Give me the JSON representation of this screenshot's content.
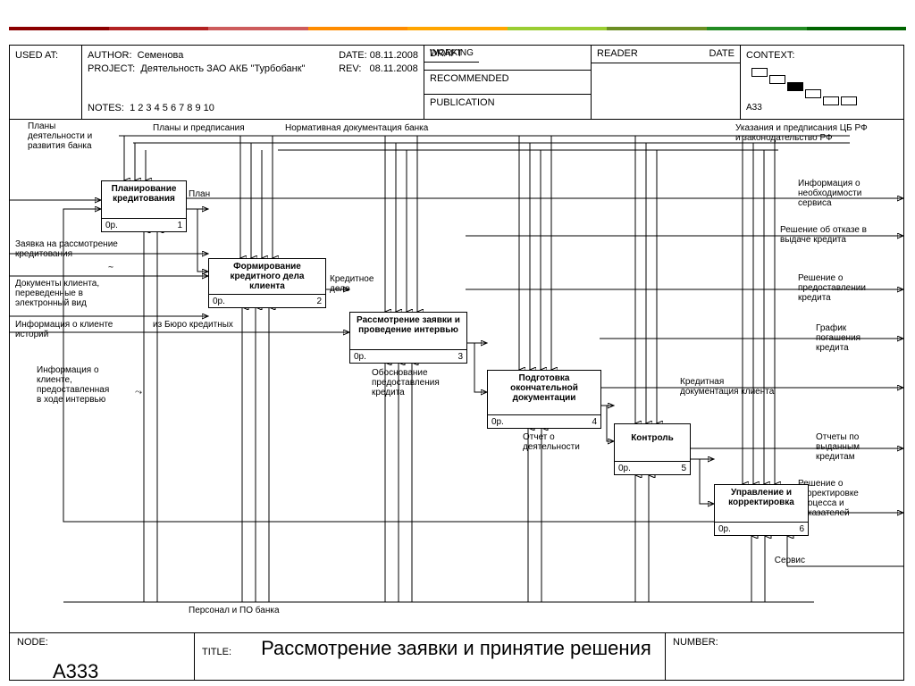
{
  "header": {
    "used_at_label": "USED AT:",
    "author_label": "AUTHOR:",
    "author": "Семенова",
    "project_label": "PROJECT:",
    "project": "Деятельность ЗАО АКБ \"Турбобанк\"",
    "notes_label": "NOTES:",
    "notes": "1  2  3  4  5  6  7  8  9  10",
    "date_label": "DATE:",
    "date": "08.11.2008",
    "rev_label": "REV:",
    "rev": "08.11.2008",
    "status": {
      "working": "WORKING",
      "draft": "DRAFT",
      "recommended": "RECOMMENDED",
      "publication": "PUBLICATION"
    },
    "reader_label": "READER",
    "reader_date_label": "DATE",
    "context_label": "CONTEXT:",
    "context_ref": "A33"
  },
  "activities": [
    {
      "n": "1",
      "op": "0р.",
      "title": "Планирование\nкредитования"
    },
    {
      "n": "2",
      "op": "0р.",
      "title": "Формирование\nкредитного дела клиента"
    },
    {
      "n": "3",
      "op": "0р.",
      "title": "Рассмотрение заявки\nи проведение интервью"
    },
    {
      "n": "4",
      "op": "0р.",
      "title": "Подготовка\nокончательной\nдокументации"
    },
    {
      "n": "5",
      "op": "0р.",
      "title": "Контроль"
    },
    {
      "n": "6",
      "op": "0р.",
      "title": "Управление и\nкорректировка"
    }
  ],
  "labels": {
    "l_plany_deyat": "Планы\nдеятельности и\nразвития банка",
    "l_plany_predp": "Планы и предписания",
    "l_norm_doc": "Нормативная документация банка",
    "l_ukaz_cb": "Указания и предписания ЦБ РФ\nи законодательство РФ",
    "l_plan": "План",
    "l_zayavka": "Заявка на рассмотрение\nкредитования",
    "l_doc_client": "Документы клиента,\nпереведенные в\nэлектронный вид",
    "l_info_client_hist": "Информация о клиенте\nисторий",
    "l_iz_buro": "из Бюро кредитных",
    "l_info_client_interview": "Информация о\nклиенте,\nпредоставленная\nв ходе интервью",
    "l_kred_delo": "Кредитное\nдело",
    "l_obosn": "Обоснование\nпредоставления\nкредита",
    "l_otchet": "Отчет о\nдеятельности",
    "l_info_service": "Информация о\nнеобходимости\nсервиса",
    "l_reshenie_otkaz": "Решение об отказе в\nвыдаче кредита",
    "l_reshenie_pred": "Решение о\nпредоставлении\nкредита",
    "l_grafik": "График\nпогашения\nкредита",
    "l_kred_doc_client": "Кредитная\nдокументация клиента",
    "l_otchety_vyd": "Отчеты по\nвыданным\nкредитам",
    "l_reshenie_korr": "Решение о\nкорректировке\nпроцесса и\nпоказателей",
    "l_service": "Сервис",
    "l_personal": "Персонал и ПО банка"
  },
  "footer": {
    "node_label": "NODE:",
    "node": "A333",
    "title_label": "TITLE:",
    "title": "Рассмотрение заявки  и принятие решения",
    "number_label": "NUMBER:"
  }
}
